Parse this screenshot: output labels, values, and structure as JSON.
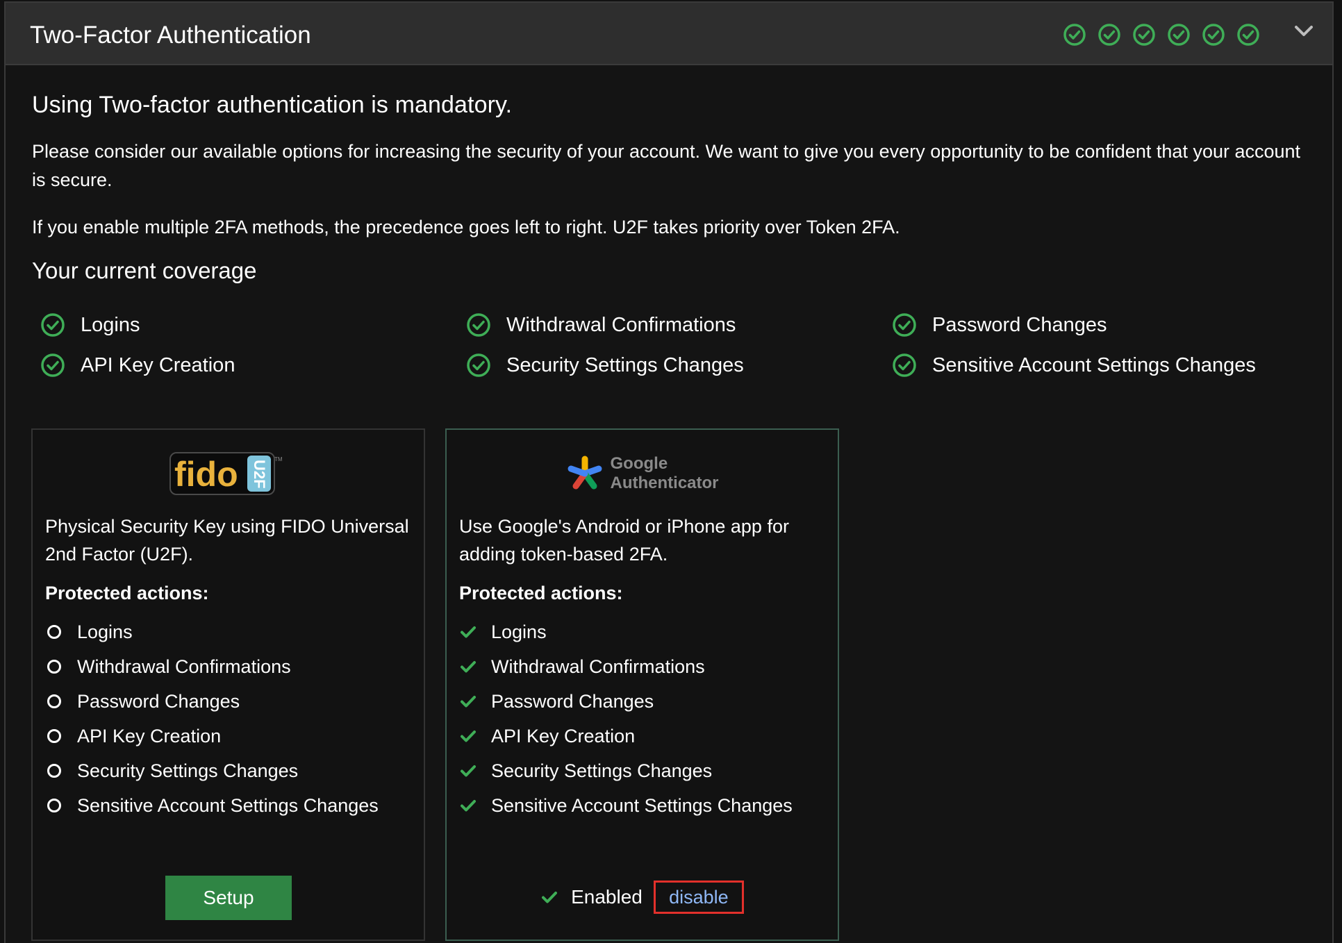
{
  "header": {
    "title": "Two-Factor Authentication",
    "status_icons": [
      "check-circle-icon",
      "check-circle-icon",
      "check-circle-icon",
      "check-circle-icon",
      "check-circle-icon",
      "check-circle-icon"
    ],
    "collapse_icon": "chevron-down-icon"
  },
  "intro": {
    "lead": "Using Two-factor authentication is mandatory.",
    "paragraph1": "Please consider our available options for increasing the security of your account. We want to give you every opportunity to be confident that your account is secure.",
    "paragraph2": "If you enable multiple 2FA methods, the precedence goes left to right. U2F takes priority over Token 2FA."
  },
  "coverage": {
    "heading": "Your current coverage",
    "items": [
      {
        "label": "Logins"
      },
      {
        "label": "Withdrawal Confirmations"
      },
      {
        "label": "Password Changes"
      },
      {
        "label": "API Key Creation"
      },
      {
        "label": "Security Settings Changes"
      },
      {
        "label": "Sensitive Account Settings Changes"
      }
    ]
  },
  "methods": {
    "fido": {
      "logo_text": "fido",
      "logo_badge": "U2F",
      "logo_tm": "TM",
      "description": "Physical Security Key using FIDO Universal 2nd Factor (U2F).",
      "protected_heading": "Protected actions:",
      "actions": [
        {
          "label": "Logins",
          "enabled": false
        },
        {
          "label": "Withdrawal Confirmations",
          "enabled": false
        },
        {
          "label": "Password Changes",
          "enabled": false
        },
        {
          "label": "API Key Creation",
          "enabled": false
        },
        {
          "label": "Security Settings Changes",
          "enabled": false
        },
        {
          "label": "Sensitive Account Settings Changes",
          "enabled": false
        }
      ],
      "setup_label": "Setup"
    },
    "google": {
      "logo_line1": "Google",
      "logo_line2": "Authenticator",
      "description": "Use Google's Android or iPhone app for adding token-based 2FA.",
      "protected_heading": "Protected actions:",
      "actions": [
        {
          "label": "Logins",
          "enabled": true
        },
        {
          "label": "Withdrawal Confirmations",
          "enabled": true
        },
        {
          "label": "Password Changes",
          "enabled": true
        },
        {
          "label": "API Key Creation",
          "enabled": true
        },
        {
          "label": "Security Settings Changes",
          "enabled": true
        },
        {
          "label": "Sensitive Account Settings Changes",
          "enabled": true
        }
      ],
      "status_label": "Enabled",
      "disable_label": "disable"
    }
  },
  "colors": {
    "check_green": "#3fae57",
    "setup_green": "#2f8544",
    "disable_border": "#e2302b",
    "disable_text": "#8fb8f6",
    "header_bg": "#2e2e2e",
    "panel_bg": "#141414"
  }
}
